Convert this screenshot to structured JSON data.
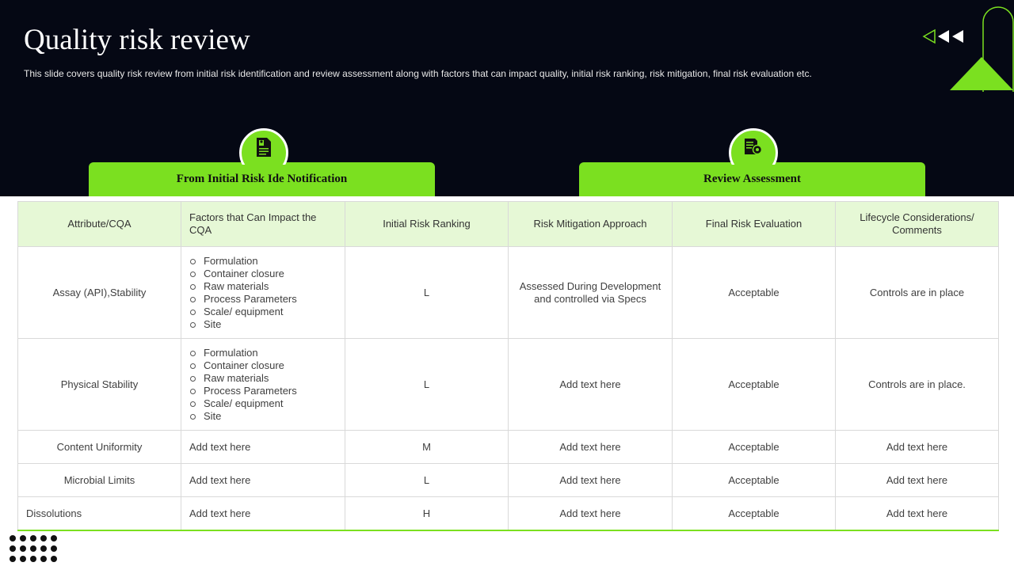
{
  "header": {
    "title": "Quality risk review",
    "subtitle": "This slide covers quality risk review from initial risk identification and review assessment along with factors that can impact quality, initial risk ranking, risk mitigation, final risk evaluation etc."
  },
  "tabs": [
    {
      "label": "From  Initial  Risk Ide Notification",
      "icon": "document-user-icon"
    },
    {
      "label": "Review Assessment",
      "icon": "document-gear-icon"
    }
  ],
  "colors": {
    "accent": "#7be020",
    "header_bg": "#050814",
    "table_header_bg": "#e6f8d6"
  },
  "table": {
    "columns": [
      "Attribute/CQA",
      "Factors that Can Impact the CQA",
      "Initial Risk Ranking",
      "Risk Mitigation Approach",
      "Final Risk Evaluation",
      "Lifecycle Considerations/ Comments"
    ],
    "rows": [
      {
        "attribute": "Assay (API),Stability",
        "factors": [
          "Formulation",
          "Container closure",
          "Raw materials",
          "Process Parameters",
          "Scale/ equipment",
          "Site"
        ],
        "ranking": "L",
        "mitigation": "Assessed During Development and controlled via Specs",
        "evaluation": "Acceptable",
        "comments": "Controls are in place"
      },
      {
        "attribute": "Physical Stability",
        "factors": [
          "Formulation",
          "Container closure",
          "Raw materials",
          "Process Parameters",
          "Scale/ equipment",
          "Site"
        ],
        "ranking": "L",
        "mitigation": "Add text here",
        "evaluation": "Acceptable",
        "comments": "Controls are in place."
      },
      {
        "attribute": "Content Uniformity",
        "factors_text": "Add text here",
        "ranking": "M",
        "mitigation": "Add text here",
        "evaluation": "Acceptable",
        "comments": "Add text here"
      },
      {
        "attribute": "Microbial Limits",
        "factors_text": "Add text here",
        "ranking": "L",
        "mitigation": "Add text here",
        "evaluation": "Acceptable",
        "comments": "Add text here"
      },
      {
        "attribute": "Dissolutions",
        "factors_text": "Add text here",
        "ranking": "H",
        "mitigation": "Add text here",
        "evaluation": "Acceptable",
        "comments": "Add text here"
      }
    ]
  }
}
